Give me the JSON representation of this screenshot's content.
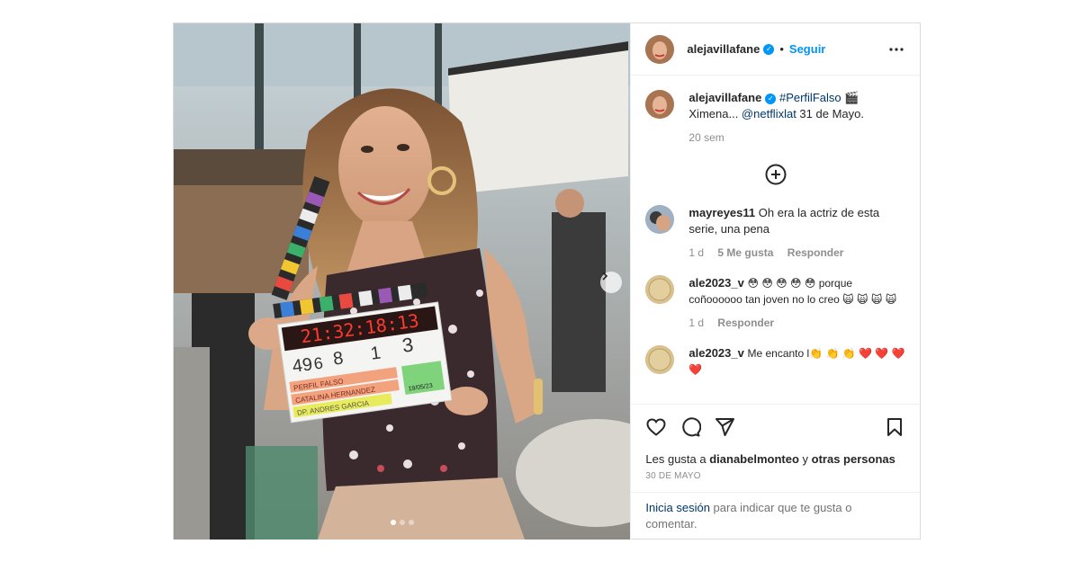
{
  "header": {
    "username": "alejavillafane",
    "separator": "•",
    "follow_label": "Seguir"
  },
  "caption": {
    "username": "alejavillafane",
    "hashtag": "#PerfilFalso",
    "emoji": "🎬",
    "text_before": "Ximena... ",
    "mention": "@netflixlat",
    "text_after": " 31 de Mayo.",
    "time": "20 sem"
  },
  "comments": [
    {
      "username": "mayreyes11",
      "text": "Oh era la actriz de esta serie, una pena",
      "time": "1 d",
      "likes": "5 Me gusta",
      "reply_label": "Responder"
    },
    {
      "username": "ale2023_v",
      "text": "😳 😳 😳 😳 😳 porque coñoooooo tan joven no lo creo 🙀 🙀 🙀 🙀",
      "time": "1 d",
      "reply_label": "Responder"
    },
    {
      "username": "ale2023_v",
      "text": "Me encanto l👏 👏 👏 ❤️ ❤️ ❤️ ❤️"
    }
  ],
  "likes": {
    "prefix": "Les gusta a ",
    "user": "dianabelmonteo",
    "connector": " y ",
    "others": "otras personas"
  },
  "date": "30 DE MAYO",
  "login": {
    "link": "Inicia sesión",
    "text": " para indicar que te gusta o comentar."
  },
  "clapperboard": {
    "timecode": "21:32:18:13",
    "scene": "49",
    "shot": "6",
    "take_a": "8",
    "take_b": "1",
    "take_c": "3",
    "title": "PERFIL FALSO",
    "director": "CATALINA HERNANDEZ",
    "dp": "DP. ANDRES GARCIA",
    "date_tag": "19/05/23"
  },
  "media": {
    "slides": 3,
    "active_slide": 1
  },
  "colors": {
    "accent": "#0095f6",
    "link": "#00376b",
    "muted": "#8e8e8e",
    "heart": "#ed4956"
  }
}
